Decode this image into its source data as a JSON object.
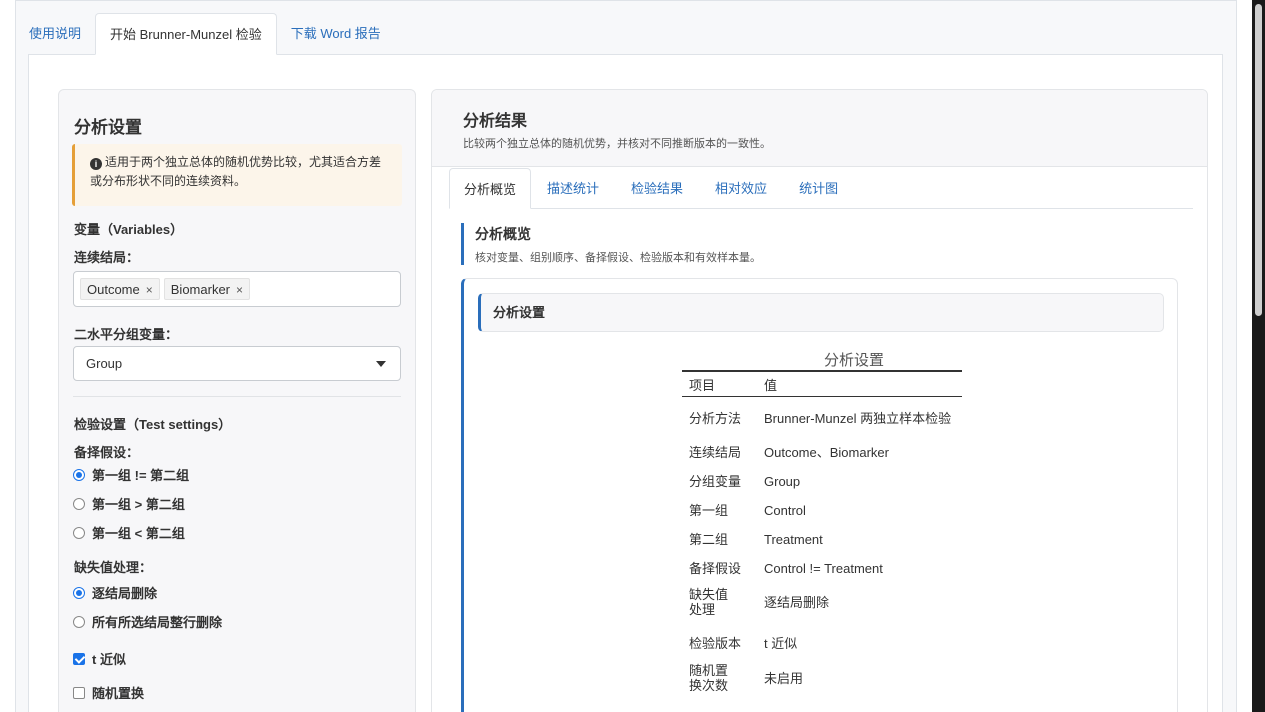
{
  "top_tabs": [
    {
      "label": "使用说明",
      "active": false
    },
    {
      "label": "开始 Brunner-Munzel 检验",
      "active": true
    },
    {
      "label": "下载 Word 报告",
      "active": false
    }
  ],
  "left": {
    "title": "分析设置",
    "info": "适用于两个独立总体的随机优势比较，尤其适合方差或分布形状不同的连续资料。",
    "info_icon": "info-icon",
    "variables_heading": "变量（Variables）",
    "continuous_label": "连续结局：",
    "continuous_tags": [
      "Outcome",
      "Biomarker"
    ],
    "tag_remove": "×",
    "group_label": "二水平分组变量：",
    "group_value": "Group",
    "test_heading": "检验设置（Test settings）",
    "alt_label": "备择假设：",
    "alt_options": [
      {
        "label": "第一组 != 第二组",
        "selected": true
      },
      {
        "label": "第一组 > 第二组",
        "selected": false
      },
      {
        "label": "第一组 < 第二组",
        "selected": false
      }
    ],
    "missing_label": "缺失值处理：",
    "missing_options": [
      {
        "label": "逐结局删除",
        "selected": true
      },
      {
        "label": "所有所选结局整行删除",
        "selected": false
      }
    ],
    "checkboxes": [
      {
        "label": "t 近似",
        "checked": true
      },
      {
        "label": "随机置换",
        "checked": false
      }
    ]
  },
  "right": {
    "title": "分析结果",
    "subtitle": "比较两个独立总体的随机优势，并核对不同推断版本的一致性。",
    "tabs": [
      {
        "label": "分析概览",
        "active": true
      },
      {
        "label": "描述统计",
        "active": false
      },
      {
        "label": "检验结果",
        "active": false
      },
      {
        "label": "相对效应",
        "active": false
      },
      {
        "label": "统计图",
        "active": false
      }
    ],
    "overview_title": "分析概览",
    "overview_sub": "核对变量、组别顺序、备择假设、检验版本和有效样本量。",
    "card_title": "分析设置",
    "table": {
      "caption": "分析设置",
      "headers": [
        "项目",
        "值"
      ],
      "rows": [
        [
          "分析方法",
          "Brunner-Munzel 两独立样本检验"
        ],
        [
          "连续结局",
          "Outcome、Biomarker"
        ],
        [
          "分组变量",
          "Group"
        ],
        [
          "第一组",
          "Control"
        ],
        [
          "第二组",
          "Treatment"
        ],
        [
          "备择假设",
          "Control != Treatment"
        ],
        [
          "缺失值处理",
          "逐结局删除"
        ],
        [
          "检验版本",
          "t 近似"
        ],
        [
          "随机置换次数",
          "未启用"
        ]
      ]
    }
  }
}
